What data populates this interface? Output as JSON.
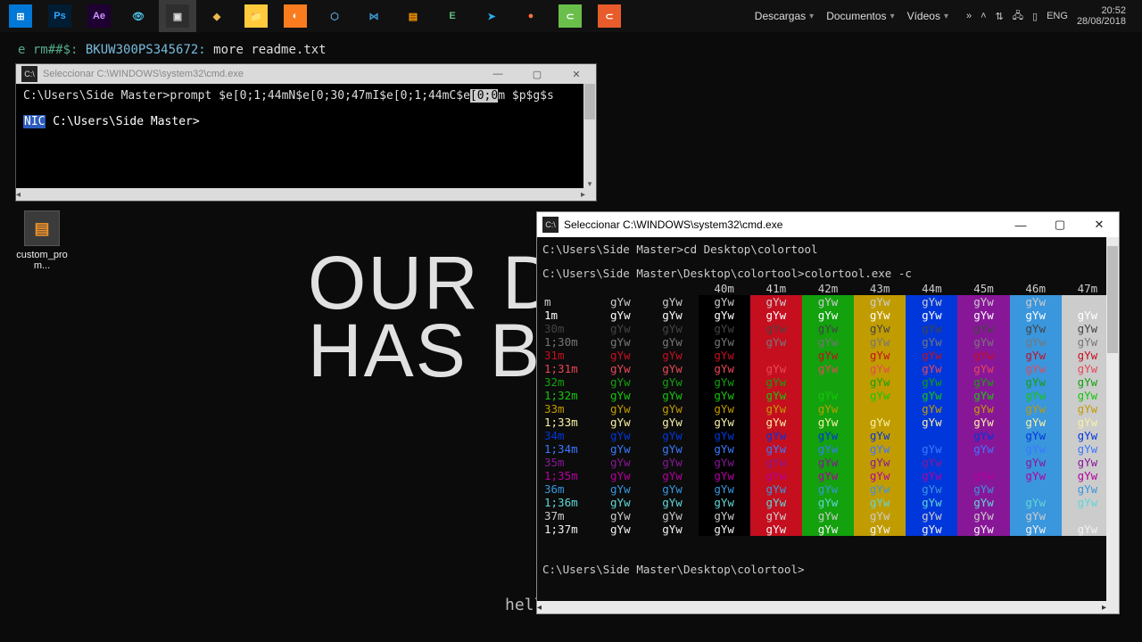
{
  "taskbar": {
    "apps": [
      {
        "name": "start-icon",
        "bg": "#0078d7",
        "label": "⊞"
      },
      {
        "name": "photoshop-icon",
        "bg": "#001d34",
        "label": "Ps",
        "fg": "#31a8ff"
      },
      {
        "name": "aftereffects-icon",
        "bg": "#1f0033",
        "label": "Ae",
        "fg": "#cf96ff"
      },
      {
        "name": "eye-icon",
        "bg": "#111",
        "label": "👁",
        "fg": "#4fc3e8"
      },
      {
        "name": "cmd-icon",
        "bg": "#2e2e2e",
        "label": "▣",
        "fg": "#ddd",
        "active": true
      },
      {
        "name": "diamond-icon",
        "bg": "#111",
        "label": "◆",
        "fg": "#e8b84f"
      },
      {
        "name": "explorer-icon",
        "bg": "#ffcb3d",
        "label": "📁",
        "fg": "#333"
      },
      {
        "name": "xampp-icon",
        "bg": "#fb7c1e",
        "label": "◐",
        "fg": "#fff"
      },
      {
        "name": "cube-icon",
        "bg": "#111",
        "label": "⬡",
        "fg": "#5aa0d8"
      },
      {
        "name": "vscode-icon",
        "bg": "#111",
        "label": "⋈",
        "fg": "#3c99d4"
      },
      {
        "name": "sublime-icon",
        "bg": "#111",
        "label": "▤",
        "fg": "#ff9800"
      },
      {
        "name": "e-icon",
        "bg": "#111",
        "label": "E",
        "fg": "#5fbf7f"
      },
      {
        "name": "telegram-icon",
        "bg": "#111",
        "label": "➤",
        "fg": "#2aabee"
      },
      {
        "name": "firefox-icon",
        "bg": "#111",
        "label": "●",
        "fg": "#ff7139"
      },
      {
        "name": "camtasia1-icon",
        "bg": "#6abf4b",
        "label": "⊂",
        "fg": "#fff"
      },
      {
        "name": "camtasia2-icon",
        "bg": "#e85c2b",
        "label": "⊂",
        "fg": "#fff"
      }
    ],
    "folders": [
      {
        "label": "Descargas"
      },
      {
        "label": "Documentos"
      },
      {
        "label": "Vídeos"
      }
    ],
    "tray": {
      "items": [
        "ᯤ",
        "▯",
        "◧"
      ],
      "lang": "ENG",
      "time": "20:52",
      "date": "28/08/2018"
    }
  },
  "bg_term": {
    "host": "e   rm##$:",
    "code": "BKUW300PS345672:",
    "cmd": "more readme.txt"
  },
  "win1": {
    "title": "Seleccionar C:\\WINDOWS\\system32\\cmd.exe",
    "line1_pre": "C:\\Users\\Side Master>prompt $e[0;1;44mN$e[0;30;47mI$e[0;1;44mC$e",
    "line1_sel": "[0;0",
    "line1_post": "m $p$g$s",
    "line2_nic": "NIC",
    "line2_rest": " C:\\Users\\Side Master>"
  },
  "desktop_file": {
    "label": "custom_prom..."
  },
  "backdrop": {
    "line1": "OUR DE",
    "line2": "HAS BEE"
  },
  "win2": {
    "title": "Seleccionar C:\\WINDOWS\\system32\\cmd.exe",
    "cmd1": "C:\\Users\\Side Master>cd Desktop\\colortool",
    "cmd2": "C:\\Users\\Side Master\\Desktop\\colortool>colortool.exe -c",
    "prompt": "C:\\Users\\Side Master\\Desktop\\colortool>",
    "gyw": "gYw",
    "headers": [
      "40m",
      "41m",
      "42m",
      "43m",
      "44m",
      "45m",
      "46m",
      "47m"
    ],
    "rows": [
      {
        "lab": "m",
        "cls": "fg-def"
      },
      {
        "lab": "1m",
        "cls": "fg-bold"
      },
      {
        "lab": "30m",
        "cls": "fg30"
      },
      {
        "lab": "1;30m",
        "cls": "fg1_30"
      },
      {
        "lab": "31m",
        "cls": "fg31"
      },
      {
        "lab": "1;31m",
        "cls": "fg1_31"
      },
      {
        "lab": "32m",
        "cls": "fg32"
      },
      {
        "lab": "1;32m",
        "cls": "fg1_32"
      },
      {
        "lab": "33m",
        "cls": "fg33"
      },
      {
        "lab": "1;33m",
        "cls": "fg1_33"
      },
      {
        "lab": "34m",
        "cls": "fg34"
      },
      {
        "lab": "1;34m",
        "cls": "fg1_34"
      },
      {
        "lab": "35m",
        "cls": "fg35"
      },
      {
        "lab": "1;35m",
        "cls": "fg1_35"
      },
      {
        "lab": "36m",
        "cls": "fg36"
      },
      {
        "lab": "1;36m",
        "cls": "fg1_36"
      },
      {
        "lab": "37m",
        "cls": "fg37"
      },
      {
        "lab": "1;37m",
        "cls": "fg1_37"
      }
    ]
  },
  "hello": "hello friend."
}
